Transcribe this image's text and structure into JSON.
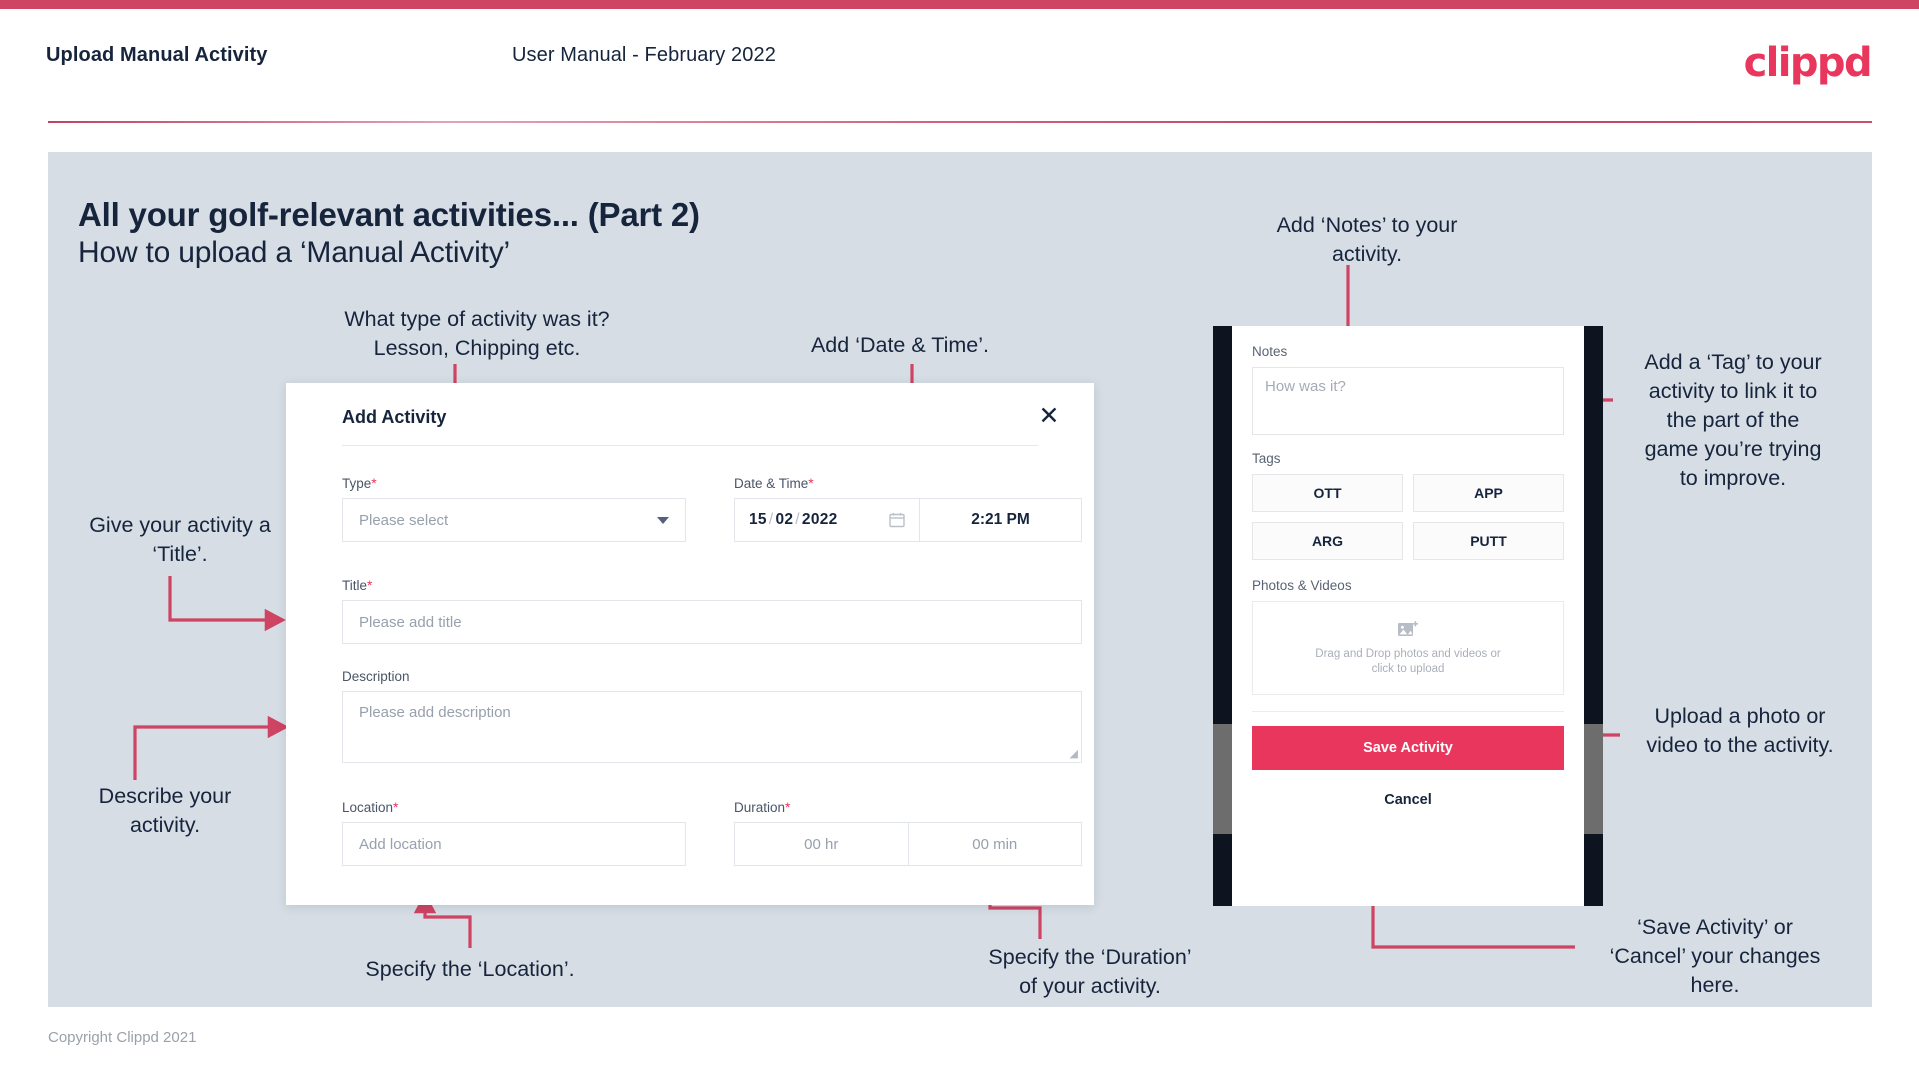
{
  "header": {
    "doc_title": "Upload Manual Activity",
    "doc_subtitle": "User Manual - February 2022",
    "brand": "clippd"
  },
  "slide": {
    "title": "All your golf-relevant activities... (Part 2)",
    "subtitle": "How to upload a ‘Manual Activity’"
  },
  "callouts": {
    "type": "What type of activity was it?\nLesson, Chipping etc.",
    "datetime": "Add ‘Date & Time’.",
    "title": "Give your activity a\n‘Title’.",
    "description": "Describe your\nactivity.",
    "location": "Specify the ‘Location’.",
    "duration": "Specify the ‘Duration’\nof your activity.",
    "notes": "Add ‘Notes’ to your\nactivity.",
    "tags": "Add a ‘Tag’ to your\nactivity to link it to\nthe part of the\ngame you’re trying\nto improve.",
    "photos": "Upload a photo or\nvideo to the activity.",
    "save_cancel": "‘Save Activity’ or\n‘Cancel’ your changes\nhere."
  },
  "dialog": {
    "title": "Add Activity",
    "close_icon": "close-icon",
    "fields": {
      "type": {
        "label": "Type",
        "required": "*",
        "placeholder": "Please select",
        "icon": "chevron-down-icon"
      },
      "datetime": {
        "label": "Date & Time",
        "required": "*",
        "day": "15",
        "month": "02",
        "year": "2022",
        "separator": "/",
        "calendar_icon": "calendar-icon",
        "time": "2:21 PM"
      },
      "title": {
        "label": "Title",
        "required": "*",
        "placeholder": "Please add title"
      },
      "description": {
        "label": "Description",
        "required": "",
        "placeholder": "Please add description"
      },
      "location": {
        "label": "Location",
        "required": "*",
        "placeholder": "Add location"
      },
      "duration": {
        "label": "Duration",
        "required": "*",
        "hours_placeholder": "00 hr",
        "minutes_placeholder": "00 min"
      }
    }
  },
  "phone": {
    "notes": {
      "label": "Notes",
      "placeholder": "How was it?"
    },
    "tags": {
      "label": "Tags",
      "items": [
        "OTT",
        "APP",
        "ARG",
        "PUTT"
      ]
    },
    "photos": {
      "label": "Photos & Videos",
      "dropzone_line1": "Drag and Drop photos and videos or",
      "dropzone_line2": "click to upload",
      "icon": "add-image-icon"
    },
    "save_label": "Save Activity",
    "cancel_label": "Cancel"
  },
  "footer": {
    "copyright": "Copyright Clippd 2021"
  },
  "colors": {
    "accent": "#e8365d",
    "accent_rule": "#cf4363",
    "panel_bg": "#d6dde5",
    "text_dark": "#16243c",
    "arrow": "#cf4363"
  }
}
